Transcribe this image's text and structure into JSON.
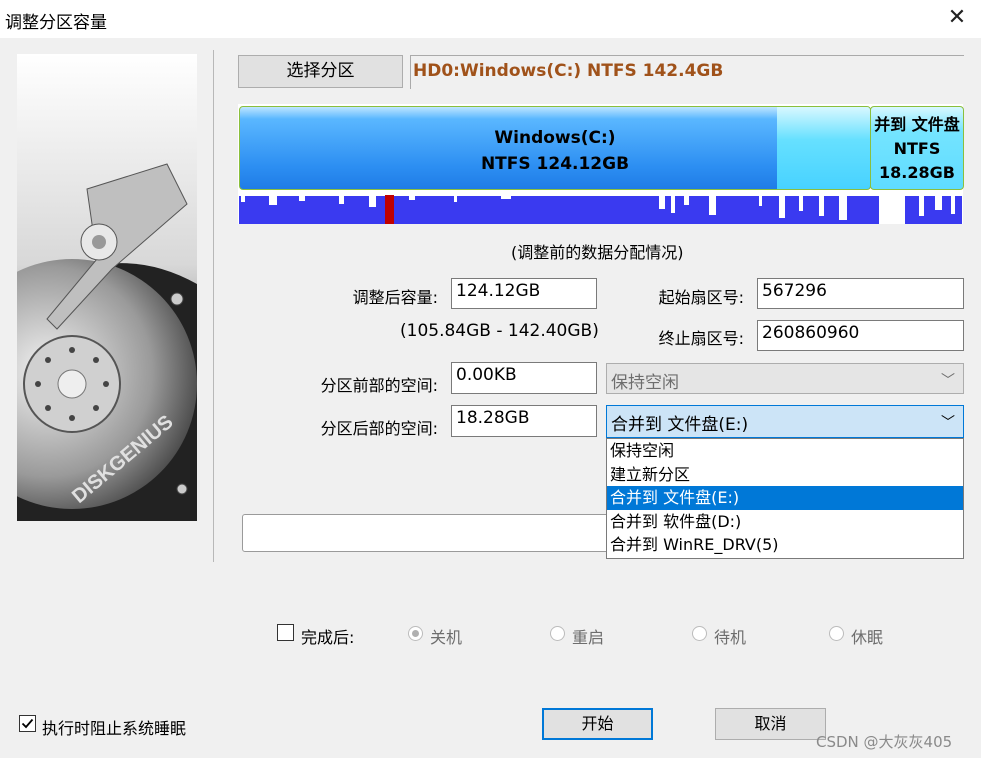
{
  "window": {
    "title": "调整分区容量",
    "close_glyph": "✕"
  },
  "top": {
    "select_partition_button": "选择分区",
    "partition_info": "HD0:Windows(C:) NTFS 142.4GB"
  },
  "disk_map": {
    "partition1": {
      "name": "Windows(C:)",
      "fs_size": "NTFS 124.12GB"
    },
    "partition2": {
      "name": "并到 文件盘",
      "fs": "NTFS",
      "size": "18.28GB"
    },
    "caption": "(调整前的数据分配情况)",
    "colors": {
      "primary": "#3aa3f7",
      "secondary": "#6de3ff",
      "border_accent": "#8bbf3c",
      "usage": "#3a3af0",
      "marker": "#c00000"
    }
  },
  "form": {
    "new_size_label": "调整后容量:",
    "new_size_value": "124.12GB",
    "size_range": "(105.84GB - 142.40GB)",
    "start_sector_label": "起始扇区号:",
    "start_sector_value": "567296",
    "end_sector_label": "终止扇区号:",
    "end_sector_value": "260860960",
    "front_space_label": "分区前部的空间:",
    "front_space_value": "0.00KB",
    "front_space_option": "保持空闲",
    "back_space_label": "分区后部的空间:",
    "back_space_value": "18.28GB",
    "back_space_option": "合并到 文件盘(E:)"
  },
  "dropdown": {
    "items": [
      "保持空闲",
      "建立新分区",
      "合并到 文件盘(E:)",
      "合并到 软件盘(D:)",
      "合并到 WinRE_DRV(5)"
    ],
    "selected_index": 2
  },
  "after_completion": {
    "checkbox_label": "完成后:",
    "checked": false,
    "options": [
      "关机",
      "重启",
      "待机",
      "休眠"
    ],
    "selected": "关机"
  },
  "bottom": {
    "prevent_sleep_label": "执行时阻止系统睡眠",
    "prevent_sleep_checked": true,
    "start_button": "开始",
    "cancel_button": "取消"
  },
  "watermark": "CSDN @大灰灰405"
}
